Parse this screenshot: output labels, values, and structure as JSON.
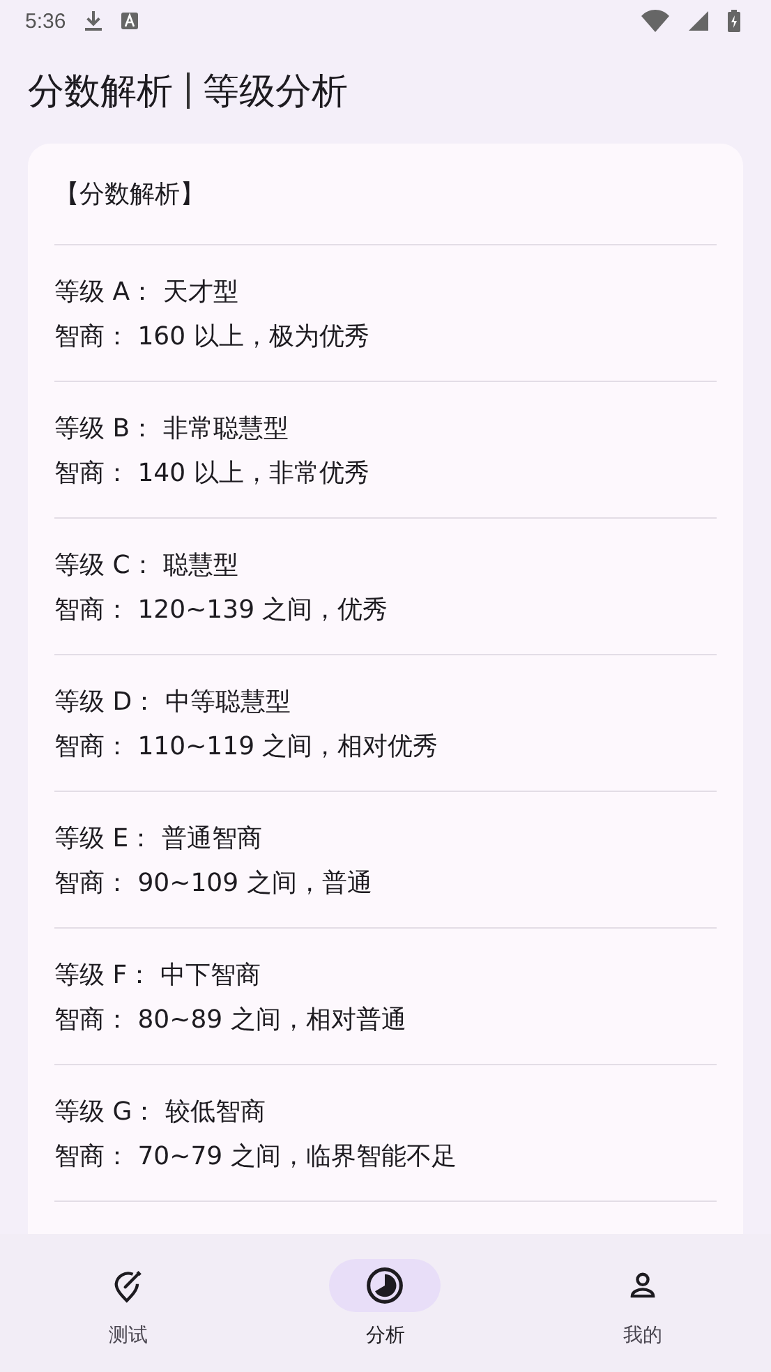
{
  "status_bar": {
    "time": "5:36"
  },
  "title": {
    "left": "分数解析",
    "right": "等级分析"
  },
  "card": {
    "heading": "【分数解析】",
    "grades": [
      {
        "grade": "等级 A： 天才型",
        "iq": "智商： 160 以上，极为优秀"
      },
      {
        "grade": "等级 B： 非常聪慧型",
        "iq": "智商： 140 以上，非常优秀"
      },
      {
        "grade": "等级 C： 聪慧型",
        "iq": "智商： 120~139 之间，优秀"
      },
      {
        "grade": "等级 D： 中等聪慧型",
        "iq": "智商： 110~119 之间，相对优秀"
      },
      {
        "grade": "等级 E： 普通智商",
        "iq": "智商： 90~109 之间，普通"
      },
      {
        "grade": "等级 F： 中下智商",
        "iq": "智商： 80~89 之间，相对普通"
      },
      {
        "grade": "等级 G： 较低智商",
        "iq": "智商： 70~79 之间，临界智能不足"
      }
    ]
  },
  "nav": [
    {
      "label": "测试",
      "kind": "test",
      "selected": false
    },
    {
      "label": "分析",
      "kind": "analysis",
      "selected": true
    },
    {
      "label": "我的",
      "kind": "profile",
      "selected": false
    }
  ]
}
